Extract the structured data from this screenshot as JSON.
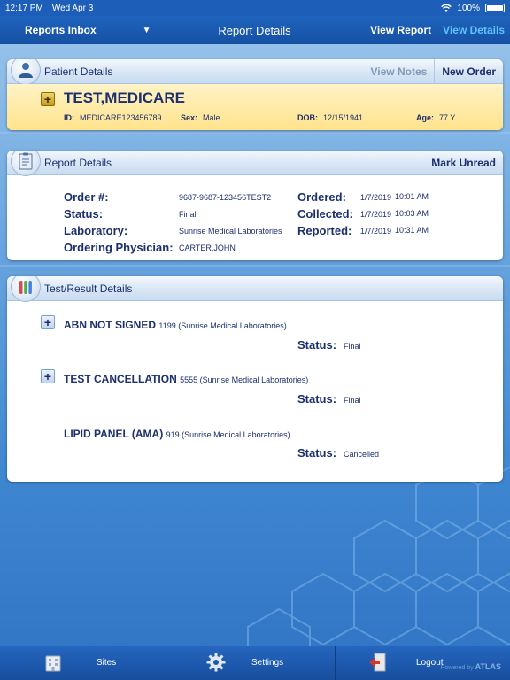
{
  "status_bar": {
    "time": "12:17 PM",
    "date": "Wed Apr 3",
    "battery": "100%"
  },
  "nav": {
    "inbox_label": "Reports Inbox",
    "title": "Report Details",
    "view_report": "View Report",
    "view_details": "View Details"
  },
  "patient_panel": {
    "header": "Patient Details",
    "view_notes": "View Notes",
    "new_order": "New Order",
    "name": "TEST,MEDICARE",
    "id_label": "ID:",
    "id_value": "MEDICARE123456789",
    "sex_label": "Sex:",
    "sex_value": "Male",
    "dob_label": "DOB:",
    "dob_value": "12/15/1941",
    "age_label": "Age:",
    "age_value": "77 Y"
  },
  "report_panel": {
    "header": "Report Details",
    "mark_unread": "Mark Unread",
    "order_label": "Order #:",
    "order_value": "9687-9687-123456TEST2",
    "status_label": "Status:",
    "status_value": "Final",
    "lab_label": "Laboratory:",
    "lab_value": "Sunrise Medical Laboratories",
    "physician_label": "Ordering Physician:",
    "physician_value": "CARTER,JOHN",
    "ordered_label": "Ordered:",
    "ordered_date": "1/7/2019",
    "ordered_time": "10:01 AM",
    "collected_label": "Collected:",
    "collected_date": "1/7/2019",
    "collected_time": "10:03 AM",
    "reported_label": "Reported:",
    "reported_date": "1/7/2019",
    "reported_time": "10:31 AM"
  },
  "tests_panel": {
    "header": "Test/Result Details",
    "status_label": "Status:",
    "tests": [
      {
        "name": "ABN NOT SIGNED",
        "detail": "1199 (Sunrise Medical Laboratories)",
        "status": "Final"
      },
      {
        "name": "TEST CANCELLATION",
        "detail": "5555 (Sunrise Medical Laboratories)",
        "status": "Final"
      },
      {
        "name": "LIPID PANEL (AMA)",
        "detail": "919 (Sunrise Medical Laboratories)",
        "status": "Cancelled"
      }
    ]
  },
  "tab_bar": {
    "sites": "Sites",
    "settings": "Settings",
    "logout": "Logout",
    "powered_by": "Powered by",
    "brand": "ATLAS"
  }
}
